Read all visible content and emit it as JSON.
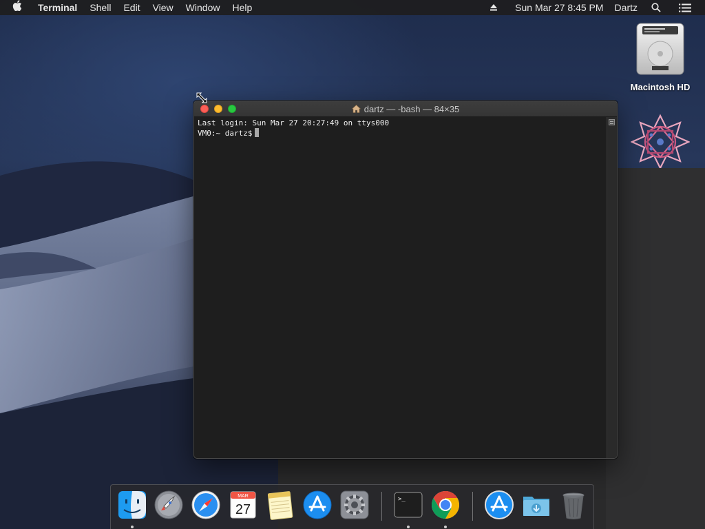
{
  "menubar": {
    "apple_glyph": "",
    "app_name": "Terminal",
    "menus": [
      "Shell",
      "Edit",
      "View",
      "Window",
      "Help"
    ],
    "datetime": "Sun Mar 27  8:45 PM",
    "user": "Dartz",
    "icons": [
      "eject-icon",
      "search-icon",
      "list-icon"
    ]
  },
  "desktop": {
    "drive_label": "Macintosh HD"
  },
  "terminal": {
    "title": "dartz — -bash — 84×35",
    "lines": [
      "Last login: Sun Mar 27 20:27:49 on ttys000",
      "VM0:~ dartz$"
    ]
  },
  "dock": {
    "items": [
      {
        "name": "finder",
        "running": true
      },
      {
        "name": "launchpad",
        "running": false
      },
      {
        "name": "safari",
        "running": false
      },
      {
        "name": "calendar",
        "running": false,
        "month": "MAR",
        "day": "27"
      },
      {
        "name": "notes",
        "running": false
      },
      {
        "name": "app-store",
        "running": false
      },
      {
        "name": "system-preferences",
        "running": false
      },
      {
        "name": "terminal",
        "running": true,
        "prompt": ">_"
      },
      {
        "name": "chrome",
        "running": true
      },
      {
        "name": "applications-folder",
        "running": false
      },
      {
        "name": "downloads-folder",
        "running": false
      },
      {
        "name": "trash",
        "running": false
      }
    ]
  },
  "colors": {
    "close": "#fc5f57",
    "minimize": "#fdbc2e",
    "maximize": "#28c840",
    "terminal_bg": "#1e1e1e"
  }
}
